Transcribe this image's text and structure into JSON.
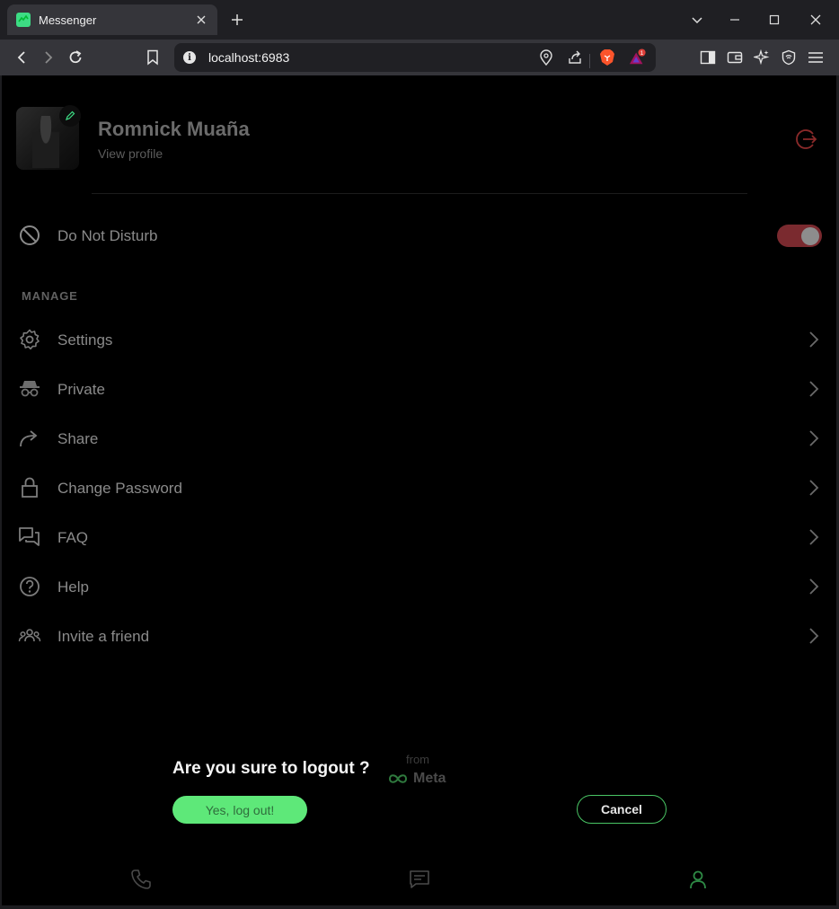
{
  "browser": {
    "tab_title": "Messenger",
    "url": "localhost:6983",
    "notification_count": "1"
  },
  "profile": {
    "name": "Romnick Muaña",
    "sub_label": "View profile"
  },
  "dnd": {
    "label": "Do Not Disturb",
    "enabled": true
  },
  "manage": {
    "section_label": "MANAGE",
    "items": [
      {
        "label": "Settings",
        "icon": "gear-icon"
      },
      {
        "label": "Private",
        "icon": "incognito-icon"
      },
      {
        "label": "Share",
        "icon": "share-arrow-icon"
      },
      {
        "label": "Change Password",
        "icon": "lock-icon"
      },
      {
        "label": "FAQ",
        "icon": "chat-bubbles-icon"
      },
      {
        "label": "Help",
        "icon": "question-circle-icon"
      },
      {
        "label": "Invite a friend",
        "icon": "group-icon"
      }
    ]
  },
  "footer": {
    "from": "from",
    "brand": "Meta"
  },
  "dialog": {
    "title": "Are you sure to logout ?",
    "confirm_label": "Yes, log out!",
    "cancel_label": "Cancel"
  },
  "colors": {
    "accent": "#5ee879",
    "danger": "#c0392b",
    "background": "#000000"
  }
}
